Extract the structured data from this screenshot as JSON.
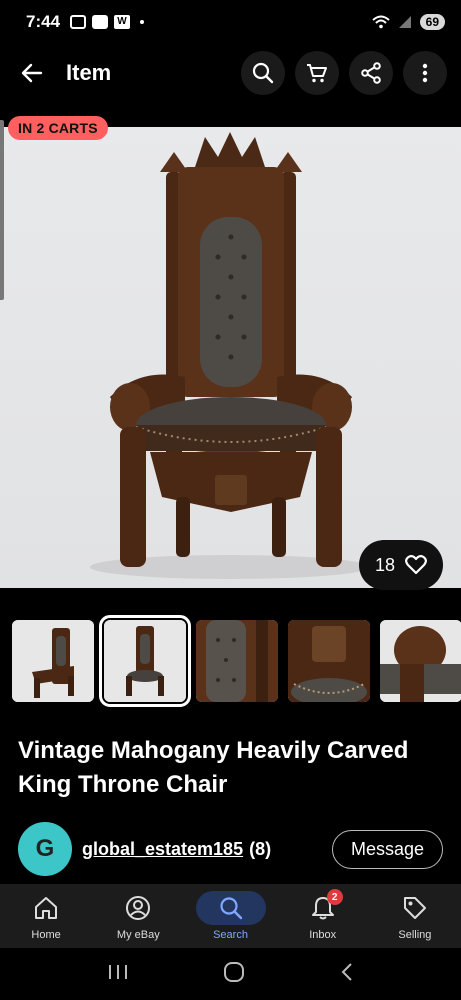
{
  "status_bar": {
    "time": "7:44",
    "battery": "69"
  },
  "app_bar": {
    "title": "Item"
  },
  "listing": {
    "cart_badge": "IN 2 CARTS",
    "watch_count": "18",
    "title": "Vintage Mahogany Heavily Carved King Throne Chair",
    "thumbnail_count": 5,
    "selected_thumbnail": 2
  },
  "seller": {
    "avatar_letter": "G",
    "name": "global_estatem185",
    "feedback": "(8)",
    "message_label": "Message"
  },
  "bottom_nav": {
    "items": [
      {
        "label": "Home",
        "icon": "home-icon"
      },
      {
        "label": "My eBay",
        "icon": "user-icon"
      },
      {
        "label": "Search",
        "icon": "search-icon",
        "active": true
      },
      {
        "label": "Inbox",
        "icon": "bell-icon",
        "badge": "2"
      },
      {
        "label": "Selling",
        "icon": "tag-icon"
      }
    ]
  },
  "colors": {
    "cart_badge": "#ff5f5f",
    "avatar": "#3cc6c8",
    "nav_active": "#7fa8ff",
    "badge": "#e0393e"
  }
}
